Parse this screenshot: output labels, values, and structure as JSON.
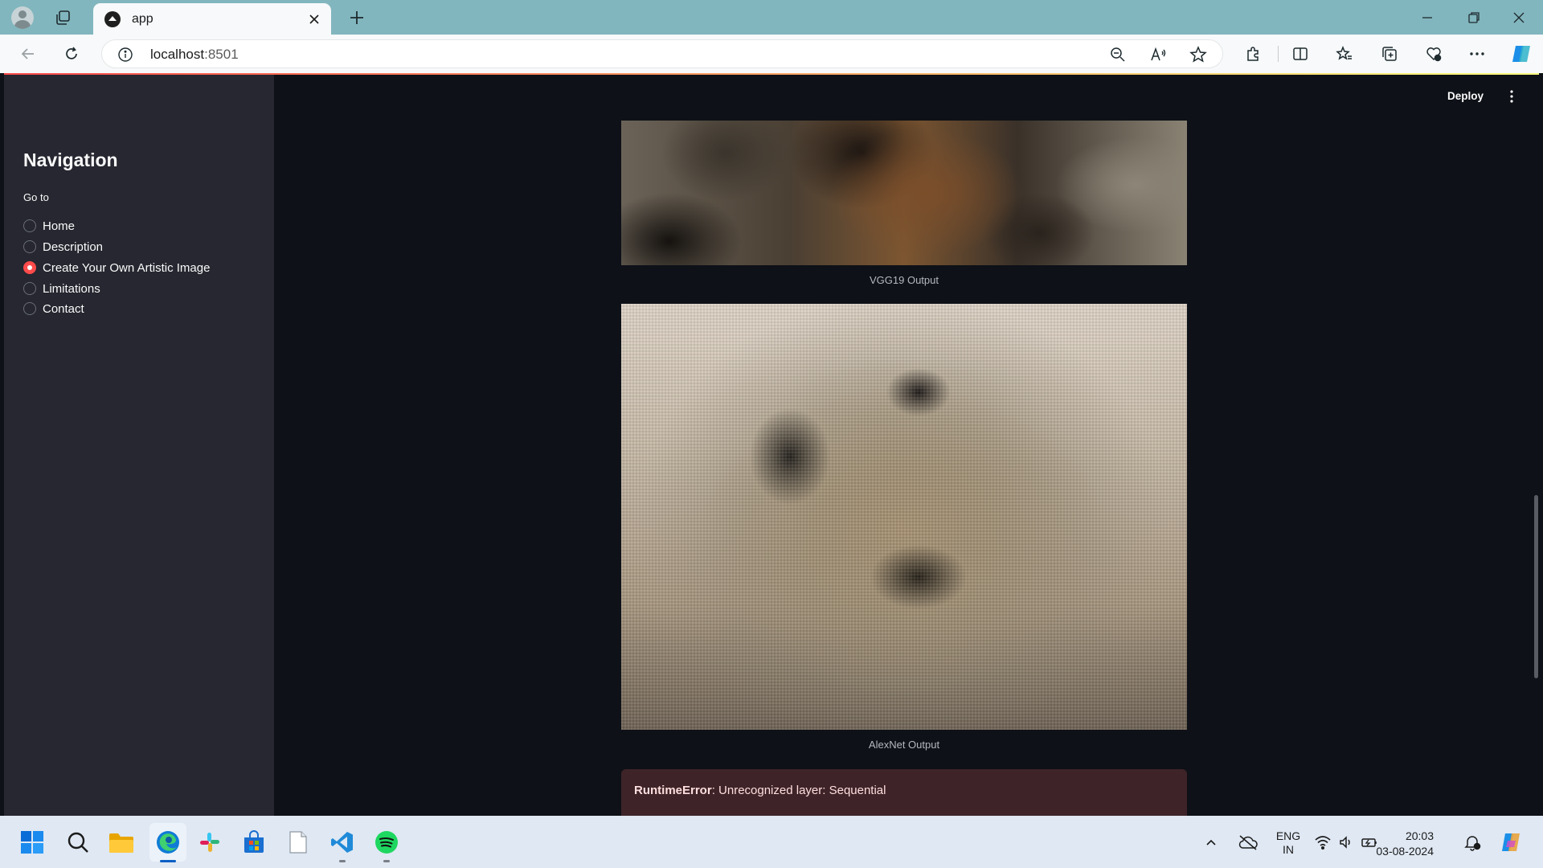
{
  "browser": {
    "tab_title": "app",
    "url_host": "localhost",
    "url_port": ":8501"
  },
  "sidebar": {
    "title": "Navigation",
    "radio_label": "Go to",
    "options": [
      {
        "label": "Home",
        "selected": false
      },
      {
        "label": "Description",
        "selected": false
      },
      {
        "label": "Create Your Own Artistic Image",
        "selected": true
      },
      {
        "label": "Limitations",
        "selected": false
      },
      {
        "label": "Contact",
        "selected": false
      }
    ]
  },
  "header": {
    "deploy_label": "Deploy"
  },
  "main": {
    "images": [
      {
        "caption": "VGG19 Output"
      },
      {
        "caption": "AlexNet Output"
      }
    ],
    "error": {
      "type": "RuntimeError",
      "message": ": Unrecognized layer: Sequential"
    }
  },
  "taskbar": {
    "language_line1": "ENG",
    "language_line2": "IN",
    "time": "20:03",
    "date": "03-08-2024"
  },
  "colors": {
    "accent": "#ff4b4b",
    "sidebar_bg": "#262730",
    "app_bg": "#0e1117",
    "error_bg": "#3e2428"
  }
}
